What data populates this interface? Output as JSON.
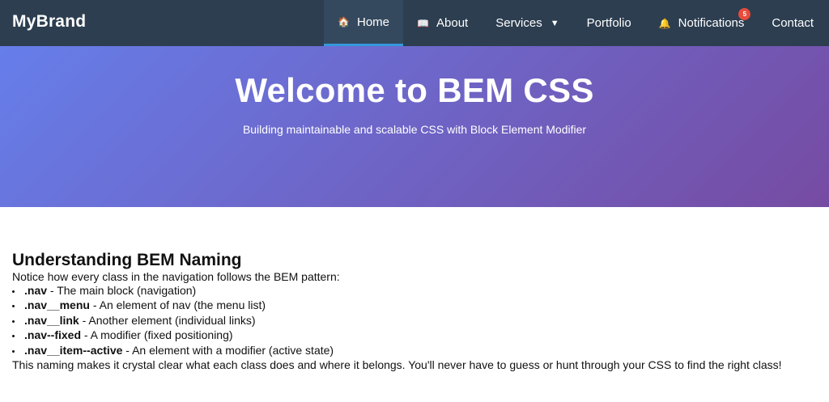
{
  "nav": {
    "brand": "MyBrand",
    "items": [
      {
        "label": "Home",
        "icon": "house-icon",
        "glyph": "🏠",
        "active": true
      },
      {
        "label": "About",
        "icon": "book-icon",
        "glyph": "📖"
      },
      {
        "label": "Services",
        "caret": "▼"
      },
      {
        "label": "Portfolio"
      },
      {
        "label": "Notifications",
        "icon": "bell-icon",
        "glyph": "🔔",
        "badge": "5"
      },
      {
        "label": "Contact"
      }
    ]
  },
  "hero": {
    "title": "Welcome to BEM CSS",
    "subtitle": "Building maintainable and scalable CSS with Block Element Modifier"
  },
  "content": {
    "title": "Understanding BEM Naming",
    "intro": "Notice how every class in the navigation follows the BEM pattern:",
    "list": [
      {
        "code": ".nav",
        "desc": " - The main block (navigation)"
      },
      {
        "code": ".nav__menu",
        "desc": " - An element of nav (the menu list)"
      },
      {
        "code": ".nav__link",
        "desc": " - Another element (individual links)"
      },
      {
        "code": ".nav--fixed",
        "desc": " - A modifier (fixed positioning)"
      },
      {
        "code": ".nav__item--active",
        "desc": " - An element with a modifier (active state)"
      }
    ],
    "outro": "This naming makes it crystal clear what each class does and where it belongs. You'll never have to guess or hunt through your CSS to find the right class!"
  },
  "colors": {
    "nav_bg": "#2c3e50",
    "active_bg": "#34495e",
    "active_border": "#3498db",
    "badge": "#e74c3c",
    "hero_start": "#667eea",
    "hero_end": "#764ba2"
  }
}
